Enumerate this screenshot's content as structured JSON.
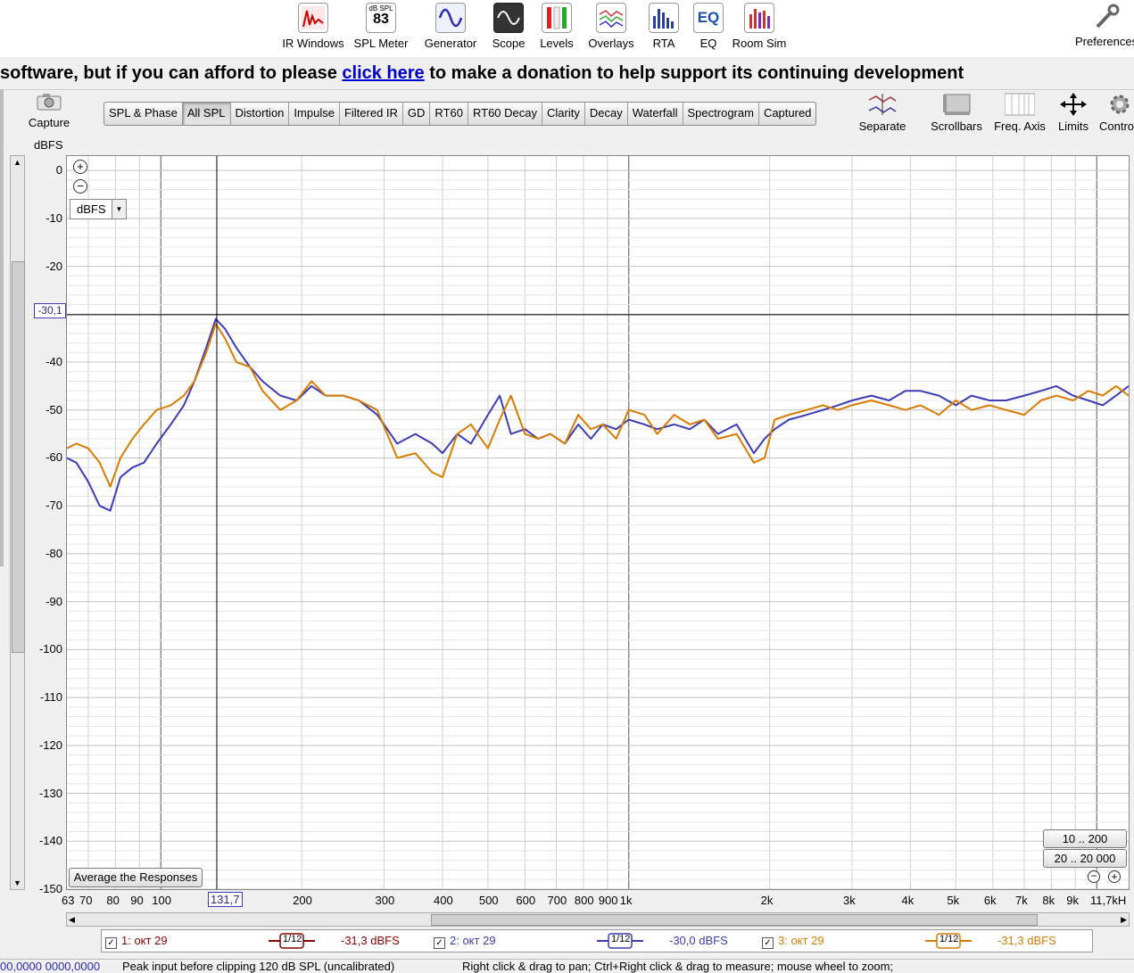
{
  "toolbar": {
    "items": [
      {
        "label": "IR Windows",
        "icon": "ir-windows-icon"
      },
      {
        "label": "SPL Meter",
        "icon": "spl-meter-icon",
        "icon_text_top": "dB SPL",
        "icon_text_value": "83"
      },
      {
        "label": "Generator",
        "icon": "generator-icon"
      },
      {
        "label": "Scope",
        "icon": "scope-icon"
      },
      {
        "label": "Levels",
        "icon": "levels-icon"
      },
      {
        "label": "Overlays",
        "icon": "overlays-icon"
      },
      {
        "label": "RTA",
        "icon": "rta-icon"
      },
      {
        "label": "EQ",
        "icon": "eq-icon",
        "icon_text": "EQ"
      },
      {
        "label": "Room Sim",
        "icon": "room-sim-icon"
      },
      {
        "label": "Preferences",
        "icon": "wrench-icon"
      }
    ]
  },
  "banner": {
    "before": "software, but if you can afford to please ",
    "link": "click here",
    "after": " to make a donation to help support its continuing development"
  },
  "capture": {
    "label": "Capture"
  },
  "unit_label": "dBFS",
  "tabs": [
    "SPL & Phase",
    "All SPL",
    "Distortion",
    "Impulse",
    "Filtered IR",
    "GD",
    "RT60",
    "RT60 Decay",
    "Clarity",
    "Decay",
    "Waterfall",
    "Spectrogram",
    "Captured"
  ],
  "active_tab": "All SPL",
  "right_tools": [
    {
      "label": "Separate",
      "icon": "separate-icon"
    },
    {
      "label": "Scrollbars",
      "icon": "scrollbars-icon"
    },
    {
      "label": "Freq. Axis",
      "icon": "freq-axis-icon"
    },
    {
      "label": "Limits",
      "icon": "limits-icon"
    },
    {
      "label": "Contro",
      "icon": "gear-icon"
    }
  ],
  "plot": {
    "unit_select": "dBFS",
    "cursor_y_label": "-30,1",
    "cursor_x_label": "131,7",
    "average_button": "Average the Responses",
    "range_button_1": "10 .. 200",
    "range_button_2": "20 .. 20 000"
  },
  "legend": [
    {
      "name": "1: окт 29",
      "smoothing": "1/12",
      "level": "-31,3 dBFS",
      "color": "#8b0000",
      "checked": true
    },
    {
      "name": "2: окт 29",
      "smoothing": "1/12",
      "level": "-30,0 dBFS",
      "color": "#3c3cb4",
      "checked": true
    },
    {
      "name": "3: окт 29",
      "smoothing": "1/12",
      "level": "-31,3 dBFS",
      "color": "#d97b00",
      "checked": true
    }
  ],
  "status": {
    "left": "00,0000  0000,0000",
    "middle": "Peak input before clipping 120 dB SPL (uncalibrated)",
    "right": "Right click & drag to pan; Ctrl+Right click & drag to measure; mouse wheel to zoom;"
  },
  "chart_data": {
    "type": "line",
    "title": "",
    "xlabel": "",
    "ylabel": "dBFS",
    "x_scale": "log",
    "xlim": [
      63,
      11700
    ],
    "ylim": [
      -150,
      3
    ],
    "x_tick_labels": [
      "63",
      "70",
      "80",
      "90",
      "100",
      "131,7",
      "200",
      "300",
      "400",
      "500",
      "600",
      "700",
      "800",
      "900",
      "1k",
      "2k",
      "3k",
      "4k",
      "5k",
      "6k",
      "7k",
      "8k",
      "9k",
      "11,7kH"
    ],
    "y_tick_labels": [
      "0",
      "-10",
      "-20",
      "-30,1",
      "-40",
      "-50",
      "-60",
      "-70",
      "-80",
      "-90",
      "-100",
      "-110",
      "-120",
      "-130",
      "-140",
      "-150"
    ],
    "grid": true,
    "cursor": {
      "x": 131.7,
      "y": -30.1
    },
    "series": [
      {
        "name": "2: окт 29",
        "color": "#3c3cb4",
        "x": [
          63,
          66,
          70,
          74,
          78,
          82,
          87,
          92,
          98,
          105,
          112,
          118,
          125,
          131,
          137,
          145,
          155,
          165,
          180,
          195,
          210,
          225,
          245,
          265,
          290,
          320,
          350,
          380,
          400,
          430,
          460,
          500,
          530,
          560,
          600,
          640,
          680,
          730,
          780,
          830,
          880,
          940,
          1000,
          1080,
          1150,
          1250,
          1350,
          1450,
          1550,
          1700,
          1850,
          1950,
          2050,
          2200,
          2400,
          2600,
          2800,
          3000,
          3300,
          3600,
          3900,
          4200,
          4600,
          5000,
          5400,
          5900,
          6400,
          7000,
          7600,
          8200,
          8900,
          9600,
          10300,
          11000,
          11700
        ],
        "y": [
          -60,
          -61,
          -65,
          -70,
          -71,
          -64,
          -62,
          -61,
          -57,
          -53,
          -49,
          -44,
          -37,
          -31,
          -33,
          -37,
          -41,
          -44,
          -47,
          -48,
          -45,
          -47,
          -47,
          -48,
          -51,
          -57,
          -55,
          -57,
          -59,
          -55,
          -57,
          -51,
          -47,
          -55,
          -54,
          -56,
          -55,
          -57,
          -53,
          -56,
          -53,
          -54,
          -52,
          -53,
          -54,
          -53,
          -54,
          -52,
          -55,
          -53,
          -59,
          -56,
          -54,
          -52,
          -51,
          -50,
          -49,
          -48,
          -47,
          -48,
          -46,
          -46,
          -47,
          -49,
          -47,
          -48,
          -48,
          -47,
          -46,
          -45,
          -47,
          -48,
          -49,
          -47,
          -45
        ]
      },
      {
        "name": "3: окт 29",
        "color": "#d97b00",
        "x": [
          63,
          66,
          70,
          74,
          78,
          82,
          87,
          92,
          98,
          105,
          112,
          118,
          125,
          131,
          137,
          145,
          155,
          165,
          180,
          195,
          210,
          225,
          245,
          265,
          290,
          320,
          350,
          380,
          400,
          430,
          460,
          500,
          530,
          560,
          600,
          640,
          680,
          730,
          780,
          830,
          880,
          940,
          1000,
          1080,
          1150,
          1250,
          1350,
          1450,
          1550,
          1700,
          1850,
          1950,
          2050,
          2200,
          2400,
          2600,
          2800,
          3000,
          3300,
          3600,
          3900,
          4200,
          4600,
          5000,
          5400,
          5900,
          6400,
          7000,
          7600,
          8200,
          8900,
          9600,
          10300,
          11000,
          11700
        ],
        "y": [
          -58,
          -57,
          -58,
          -61,
          -66,
          -60,
          -56,
          -53,
          -50,
          -49,
          -47,
          -44,
          -38,
          -32,
          -35,
          -40,
          -41,
          -46,
          -50,
          -48,
          -44,
          -47,
          -47,
          -48,
          -50,
          -60,
          -59,
          -63,
          -64,
          -55,
          -53,
          -58,
          -52,
          -47,
          -55,
          -56,
          -55,
          -57,
          -51,
          -54,
          -53,
          -56,
          -50,
          -51,
          -55,
          -51,
          -53,
          -52,
          -56,
          -55,
          -61,
          -60,
          -52,
          -51,
          -50,
          -49,
          -50,
          -49,
          -48,
          -49,
          -50,
          -49,
          -51,
          -48,
          -50,
          -49,
          -50,
          -51,
          -48,
          -47,
          -48,
          -46,
          -47,
          -45,
          -47
        ]
      }
    ]
  }
}
